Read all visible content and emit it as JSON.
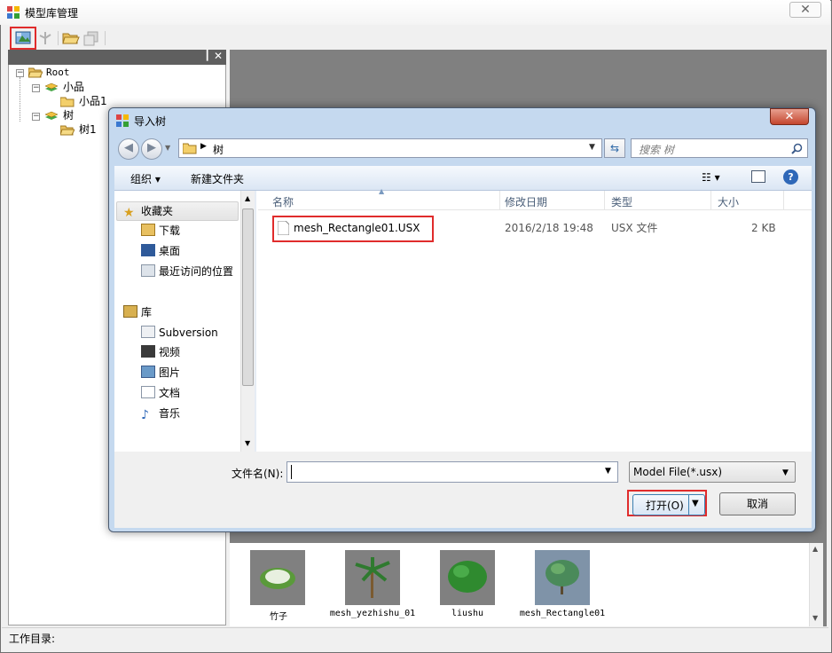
{
  "window": {
    "title": "模型库管理"
  },
  "left_panel": {
    "pin": "📌",
    "close": "✕"
  },
  "tree": {
    "root": "Root",
    "nodes": [
      {
        "label": "小品",
        "children": [
          "小品1"
        ]
      },
      {
        "label": "树",
        "children": [
          "树1"
        ]
      }
    ]
  },
  "gallery": {
    "items": [
      {
        "label": "竹子"
      },
      {
        "label": "mesh_yezhishu_01"
      },
      {
        "label": "liushu"
      },
      {
        "label": "mesh_Rectangle01"
      }
    ]
  },
  "status": {
    "label": "工作目录:"
  },
  "dialog": {
    "title": "导入树",
    "close": "✕",
    "address": {
      "folder": "树"
    },
    "search": {
      "placeholder": "搜索 树"
    },
    "toolbar": {
      "organize": "组织 ▾",
      "new_folder": "新建文件夹"
    },
    "nav": {
      "favorites": "收藏夹",
      "downloads": "下载",
      "desktop": "桌面",
      "recent": "最近访问的位置",
      "libraries": "库",
      "subversion": "Subversion",
      "videos": "视频",
      "pictures": "图片",
      "documents": "文档",
      "music": "音乐"
    },
    "columns": {
      "name": "名称",
      "date": "修改日期",
      "type": "类型",
      "size": "大小"
    },
    "files": [
      {
        "name": "mesh_Rectangle01.USX",
        "date": "2016/2/18 19:48",
        "type": "USX 文件",
        "size": "2 KB"
      }
    ],
    "filename_label": "文件名(N):",
    "filename_value": "",
    "filetype": "Model File(*.usx)",
    "open_label": "打开(O)",
    "cancel_label": "取消"
  },
  "colors": {
    "highlight": "#e02c2c",
    "dialog_frame": "#c5d9ef",
    "viewport": "#808080"
  }
}
